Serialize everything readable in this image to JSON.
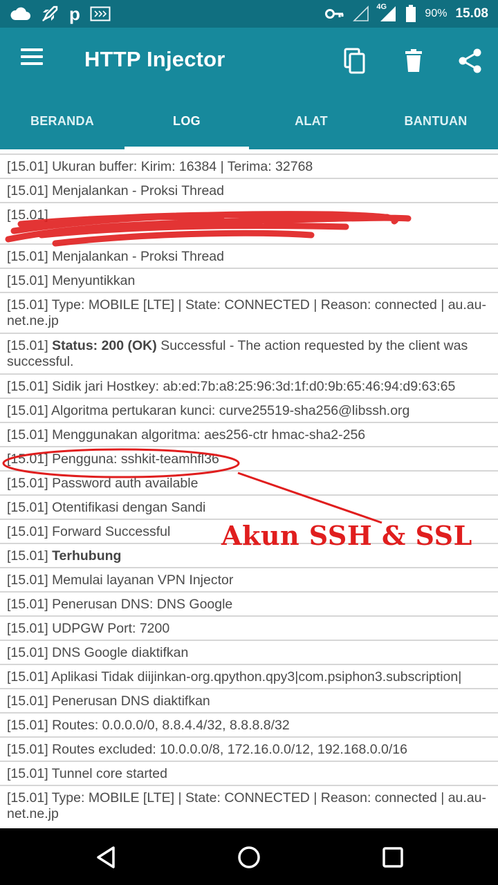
{
  "status_bar": {
    "icons": [
      "cloud-icon",
      "rocket-icon",
      "p-icon",
      "cast-icon",
      "key-icon",
      "signal-empty-icon",
      "signal-4g-icon",
      "battery-icon"
    ],
    "p_glyph": "p",
    "network_label": "4G",
    "battery": "90%",
    "time": "15.08"
  },
  "app_bar": {
    "title": "HTTP Injector",
    "actions": [
      "copy-icon",
      "delete-icon",
      "share-icon"
    ]
  },
  "tabs": [
    {
      "label": "BERANDA",
      "active": false
    },
    {
      "label": "LOG",
      "active": true
    },
    {
      "label": "ALAT",
      "active": false
    },
    {
      "label": "BANTUAN",
      "active": false
    }
  ],
  "log": {
    "rows": [
      {
        "time": "[15.01]",
        "text": "Ukuran buffer: Kirim: 16384 | Terima: 32768"
      },
      {
        "time": "[15.01]",
        "text": "Menjalankan - Proksi Thread"
      },
      {
        "time": "[15.01]",
        "text": ""
      },
      {
        "time": "[15.01]",
        "text": "Menjalankan - Proksi Thread"
      },
      {
        "time": "[15.01]",
        "text": "Menyuntikkan"
      },
      {
        "time": "[15.01]",
        "text": "Type: MOBILE [LTE] | State: CONNECTED | Reason: connected | au.au-net.ne.jp"
      },
      {
        "time": "[15.01]",
        "bold": "Status: 200 (OK)",
        "text": "Successful - The action requested by the client was successful."
      },
      {
        "time": "[15.01]",
        "text": "Sidik jari Hostkey: ab:ed:7b:a8:25:96:3d:1f:d0:9b:65:46:94:d9:63:65"
      },
      {
        "time": "[15.01]",
        "text": "Algoritma pertukaran kunci: curve25519-sha256@libssh.org"
      },
      {
        "time": "[15.01]",
        "text": "Menggunakan algoritma: aes256-ctr hmac-sha2-256"
      },
      {
        "time": "[15.01]",
        "text": "Pengguna: sshkit-teamhfl36"
      },
      {
        "time": "[15.01]",
        "text": "Password auth available"
      },
      {
        "time": "[15.01]",
        "text": "Otentifikasi dengan Sandi"
      },
      {
        "time": "[15.01]",
        "text": "Forward Successful"
      },
      {
        "time": "[15.01]",
        "bold": "Terhubung",
        "text": ""
      },
      {
        "time": "[15.01]",
        "text": "Memulai layanan VPN Injector"
      },
      {
        "time": "[15.01]",
        "text": "Penerusan DNS: DNS Google"
      },
      {
        "time": "[15.01]",
        "text": "UDPGW Port: 7200"
      },
      {
        "time": "[15.01]",
        "text": "DNS Google diaktifkan"
      },
      {
        "time": "[15.01]",
        "text": "Aplikasi Tidak diijinkan-org.qpython.qpy3|com.psiphon3.subscription|"
      },
      {
        "time": "[15.01]",
        "text": "Penerusan DNS diaktifkan"
      },
      {
        "time": "[15.01]",
        "text": "Routes: 0.0.0.0/0, 8.8.4.4/32, 8.8.8.8/32"
      },
      {
        "time": "[15.01]",
        "text": "Routes excluded: 10.0.0.0/8, 172.16.0.0/12, 192.168.0.0/16"
      },
      {
        "time": "[15.01]",
        "text": "Tunnel core started"
      },
      {
        "time": "[15.01]",
        "text": "Type: MOBILE [LTE] | State: CONNECTED | Reason: connected | au.au-net.ne.jp"
      }
    ]
  },
  "annotation": {
    "label": "Akun SSH & SSL",
    "color": "#e01e1e"
  },
  "colors": {
    "status_bar": "#106f80",
    "app_bar": "#17899c",
    "divider": "#d6d6d6",
    "text": "#4b4b4b"
  },
  "nav_bar": [
    "back-icon",
    "home-icon",
    "recents-icon"
  ]
}
